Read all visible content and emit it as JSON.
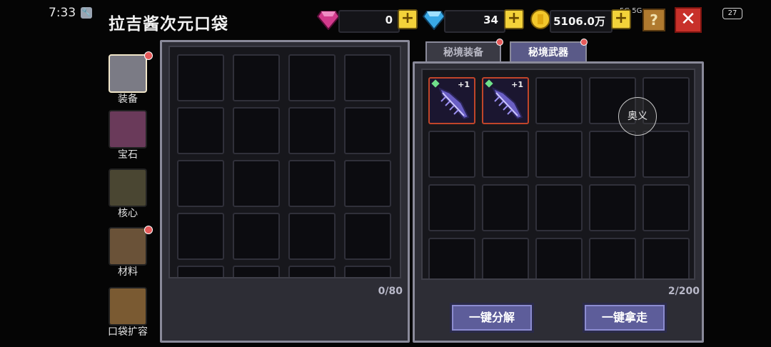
{
  "status_bar": {
    "time": "7:33",
    "battery": "27",
    "signal": "5G 5G"
  },
  "title": "拉吉酱次元口袋",
  "currencies": [
    {
      "icon": "pink-gem-icon",
      "value": "0"
    },
    {
      "icon": "blue-diamond-icon",
      "value": "34"
    },
    {
      "icon": "gold-coin-icon",
      "value": "5106.0万"
    }
  ],
  "header": {
    "help_icon": "?",
    "close_icon": "✕"
  },
  "sidebar": {
    "items": [
      {
        "label": "装备",
        "icon": "armor-icon",
        "active": true,
        "dot": true
      },
      {
        "label": "宝石",
        "icon": "crystal-icon",
        "active": false,
        "dot": false
      },
      {
        "label": "核心",
        "icon": "core-icon",
        "active": false,
        "dot": false
      },
      {
        "label": "材料",
        "icon": "book-icon",
        "active": false,
        "dot": true
      },
      {
        "label": "口袋扩容",
        "icon": "chest-icon",
        "active": false,
        "dot": false
      }
    ]
  },
  "left_panel": {
    "count": "0/80"
  },
  "right_panel": {
    "tabs": [
      {
        "label": "秘境装备",
        "active": false
      },
      {
        "label": "秘境武器",
        "active": true
      }
    ],
    "count": "2/200",
    "items": [
      {
        "name": "feather-weapon",
        "level": "+1"
      },
      {
        "name": "feather-weapon",
        "level": "+1"
      }
    ],
    "overlay_label": "奥义",
    "buttons": {
      "decompose": "一键分解",
      "take_all": "一键拿走"
    }
  }
}
